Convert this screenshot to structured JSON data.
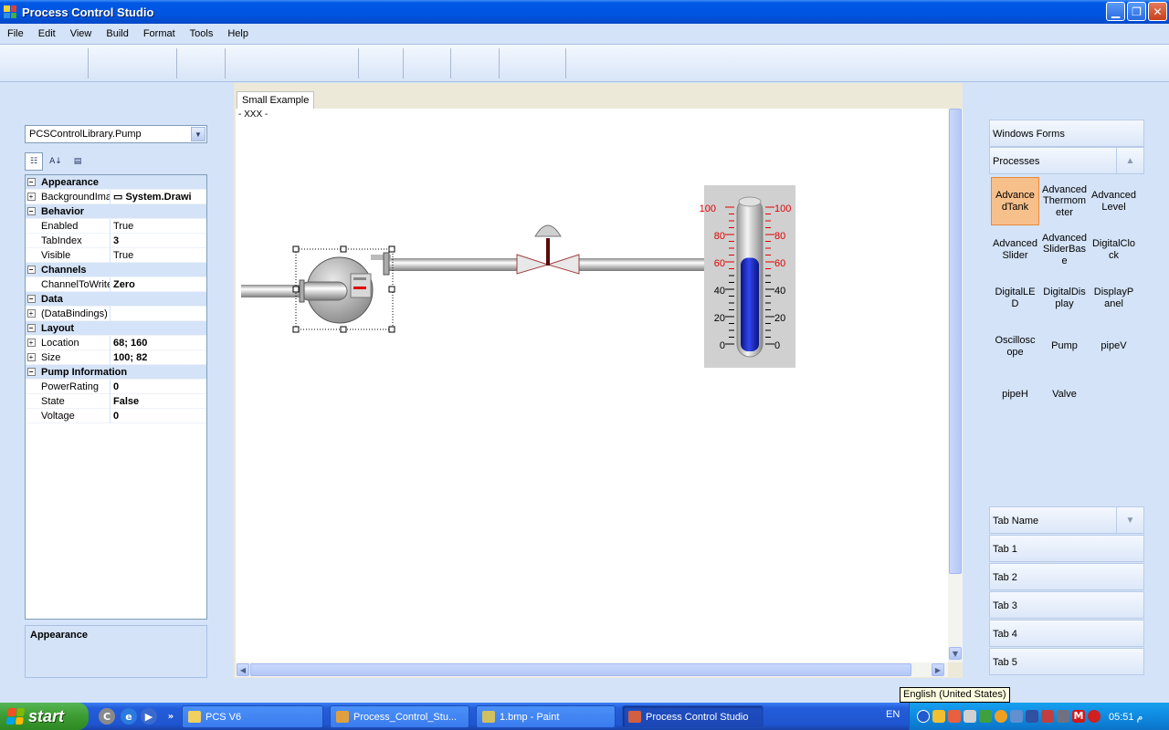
{
  "window": {
    "title": "Process Control Studio"
  },
  "menu": [
    "File",
    "Edit",
    "View",
    "Build",
    "Format",
    "Tools",
    "Help"
  ],
  "properties": {
    "selected_object": "PCSControlLibrary.Pump",
    "rows": [
      {
        "type": "cat",
        "name": "Appearance"
      },
      {
        "type": "prop",
        "name": "BackgroundIma",
        "value": "System.Drawi",
        "bold": true,
        "expandable": true,
        "icon": true
      },
      {
        "type": "cat",
        "name": "Behavior"
      },
      {
        "type": "prop",
        "name": "Enabled",
        "value": "True"
      },
      {
        "type": "prop",
        "name": "TabIndex",
        "value": "3",
        "bold": true
      },
      {
        "type": "prop",
        "name": "Visible",
        "value": "True"
      },
      {
        "type": "cat",
        "name": "Channels"
      },
      {
        "type": "prop",
        "name": "ChannelToWrite",
        "value": "Zero",
        "bold": true
      },
      {
        "type": "cat",
        "name": "Data"
      },
      {
        "type": "prop",
        "name": "(DataBindings)",
        "value": "",
        "expandable": true
      },
      {
        "type": "cat",
        "name": "Layout"
      },
      {
        "type": "prop",
        "name": "Location",
        "value": "68; 160",
        "bold": true,
        "expandable": true
      },
      {
        "type": "prop",
        "name": "Size",
        "value": "100; 82",
        "bold": true,
        "expandable": true
      },
      {
        "type": "cat",
        "name": "Pump Information"
      },
      {
        "type": "prop",
        "name": "PowerRating",
        "value": "0",
        "bold": true
      },
      {
        "type": "prop",
        "name": "State",
        "value": "False",
        "bold": true
      },
      {
        "type": "prop",
        "name": "Voltage",
        "value": "0",
        "bold": true
      }
    ],
    "description": "Appearance"
  },
  "designer": {
    "tab": "Small Example",
    "canvas_label": "- XXX -",
    "thermometer": {
      "scale_left": [
        "100",
        "80",
        "60",
        "40",
        "20",
        "0"
      ],
      "scale_right": [
        "100",
        "80",
        "60",
        "40",
        "20",
        "0"
      ],
      "level": 0.63,
      "fill_color": "#1f2fd8"
    }
  },
  "toolbox": {
    "header_windows_forms": "Windows Forms",
    "header_processes": "Processes",
    "items": [
      "AdvancedTank",
      "AdvancedThermometer",
      "AdvancedLevel",
      "AdvancedSlider",
      "AdvancedSliderBase",
      "DigitalClock",
      "DigitalLED",
      "DigitalDisplay",
      "DisplayPanel",
      "Oscilloscope",
      "Pump",
      "pipeV",
      "pipeH",
      "Valve"
    ],
    "selected": "AdvancedTank",
    "tab_header": "Tab Name",
    "tabs": [
      "Tab 1",
      "Tab 2",
      "Tab 3",
      "Tab 4",
      "Tab 5"
    ]
  },
  "tooltip": "English (United States)",
  "taskbar": {
    "start": "start",
    "buttons": [
      {
        "label": "PCS V6",
        "active": false
      },
      {
        "label": "Process_Control_Stu...",
        "active": false
      },
      {
        "label": "1.bmp - Paint",
        "active": false
      },
      {
        "label": "Process Control Studio",
        "active": true
      }
    ],
    "lang": "EN",
    "clock": "05:51 م"
  }
}
